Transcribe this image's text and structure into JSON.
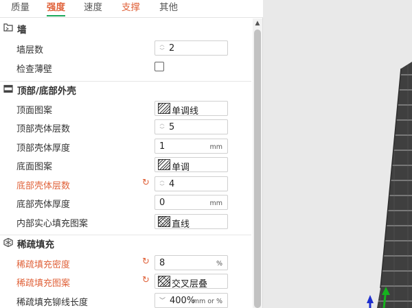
{
  "tabs": [
    {
      "label": "质量"
    },
    {
      "label": "强度"
    },
    {
      "label": "速度"
    },
    {
      "label": "支撑"
    },
    {
      "label": "其他"
    }
  ],
  "sections": {
    "wall": {
      "title": "墙"
    },
    "top_bottom": {
      "title": "顶部/底部外壳"
    },
    "sparse": {
      "title": "稀疏填充"
    }
  },
  "rows": {
    "wall_loops": {
      "label": "墙层数",
      "value": "2"
    },
    "detect_thin_wall": {
      "label": "检查薄壁",
      "checked": false
    },
    "top_pattern": {
      "label": "顶面图案",
      "value": "单调线"
    },
    "top_layers": {
      "label": "顶部壳体层数",
      "value": "5"
    },
    "top_thickness": {
      "label": "顶部壳体厚度",
      "value": "1",
      "unit": "mm"
    },
    "bottom_pattern": {
      "label": "底面图案",
      "value": "单调"
    },
    "bottom_layers": {
      "label": "底部壳体层数",
      "value": "4"
    },
    "bottom_thickness": {
      "label": "底部壳体厚度",
      "value": "0",
      "unit": "mm"
    },
    "internal_solid_pattern": {
      "label": "内部实心填充图案",
      "value": "直线"
    },
    "sparse_density": {
      "label": "稀疏填充密度",
      "value": "8",
      "unit": "%"
    },
    "sparse_pattern": {
      "label": "稀疏填充图案",
      "value": "交叉层叠"
    },
    "sparse_anchor": {
      "label": "稀疏填充铆线长度",
      "value": "400%",
      "unit": "mm or %"
    }
  },
  "colors": {
    "accent": "#e0623a",
    "tab_underline": "#1aa85b"
  }
}
